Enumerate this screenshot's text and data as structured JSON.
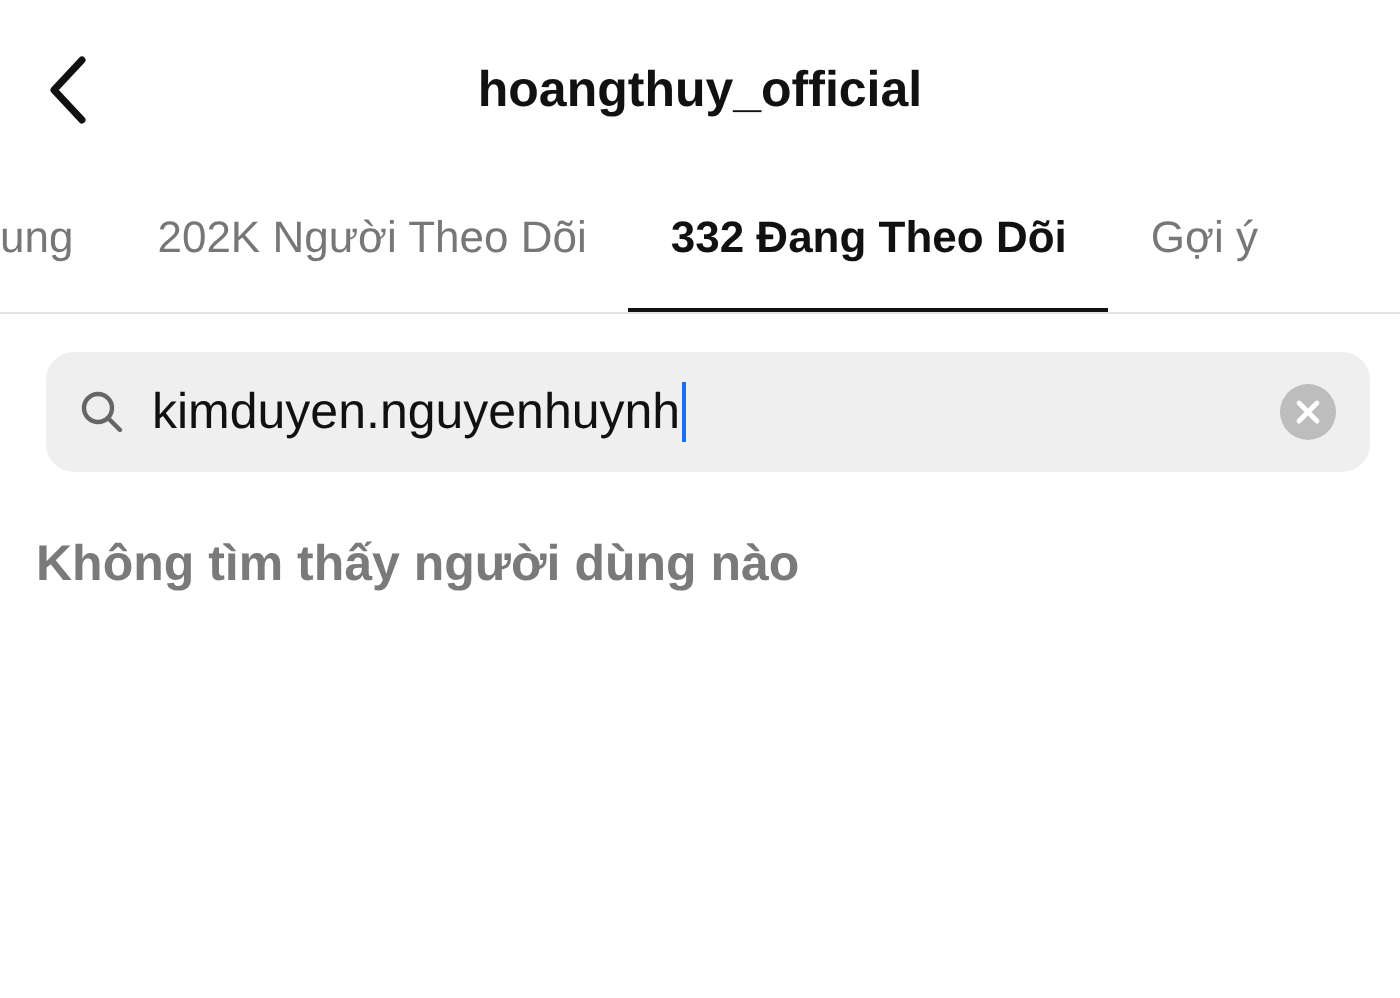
{
  "header": {
    "title": "hoangthuy_official"
  },
  "tabs": [
    {
      "label": "ung",
      "selected": false
    },
    {
      "label": "202K Người Theo Dõi",
      "selected": false
    },
    {
      "label": "332 Đang Theo Dõi",
      "selected": true
    },
    {
      "label": "Gợi ý",
      "selected": false
    }
  ],
  "search": {
    "value": "kimduyen.nguyenhuynh"
  },
  "message": "Không tìm thấy người dùng nào"
}
